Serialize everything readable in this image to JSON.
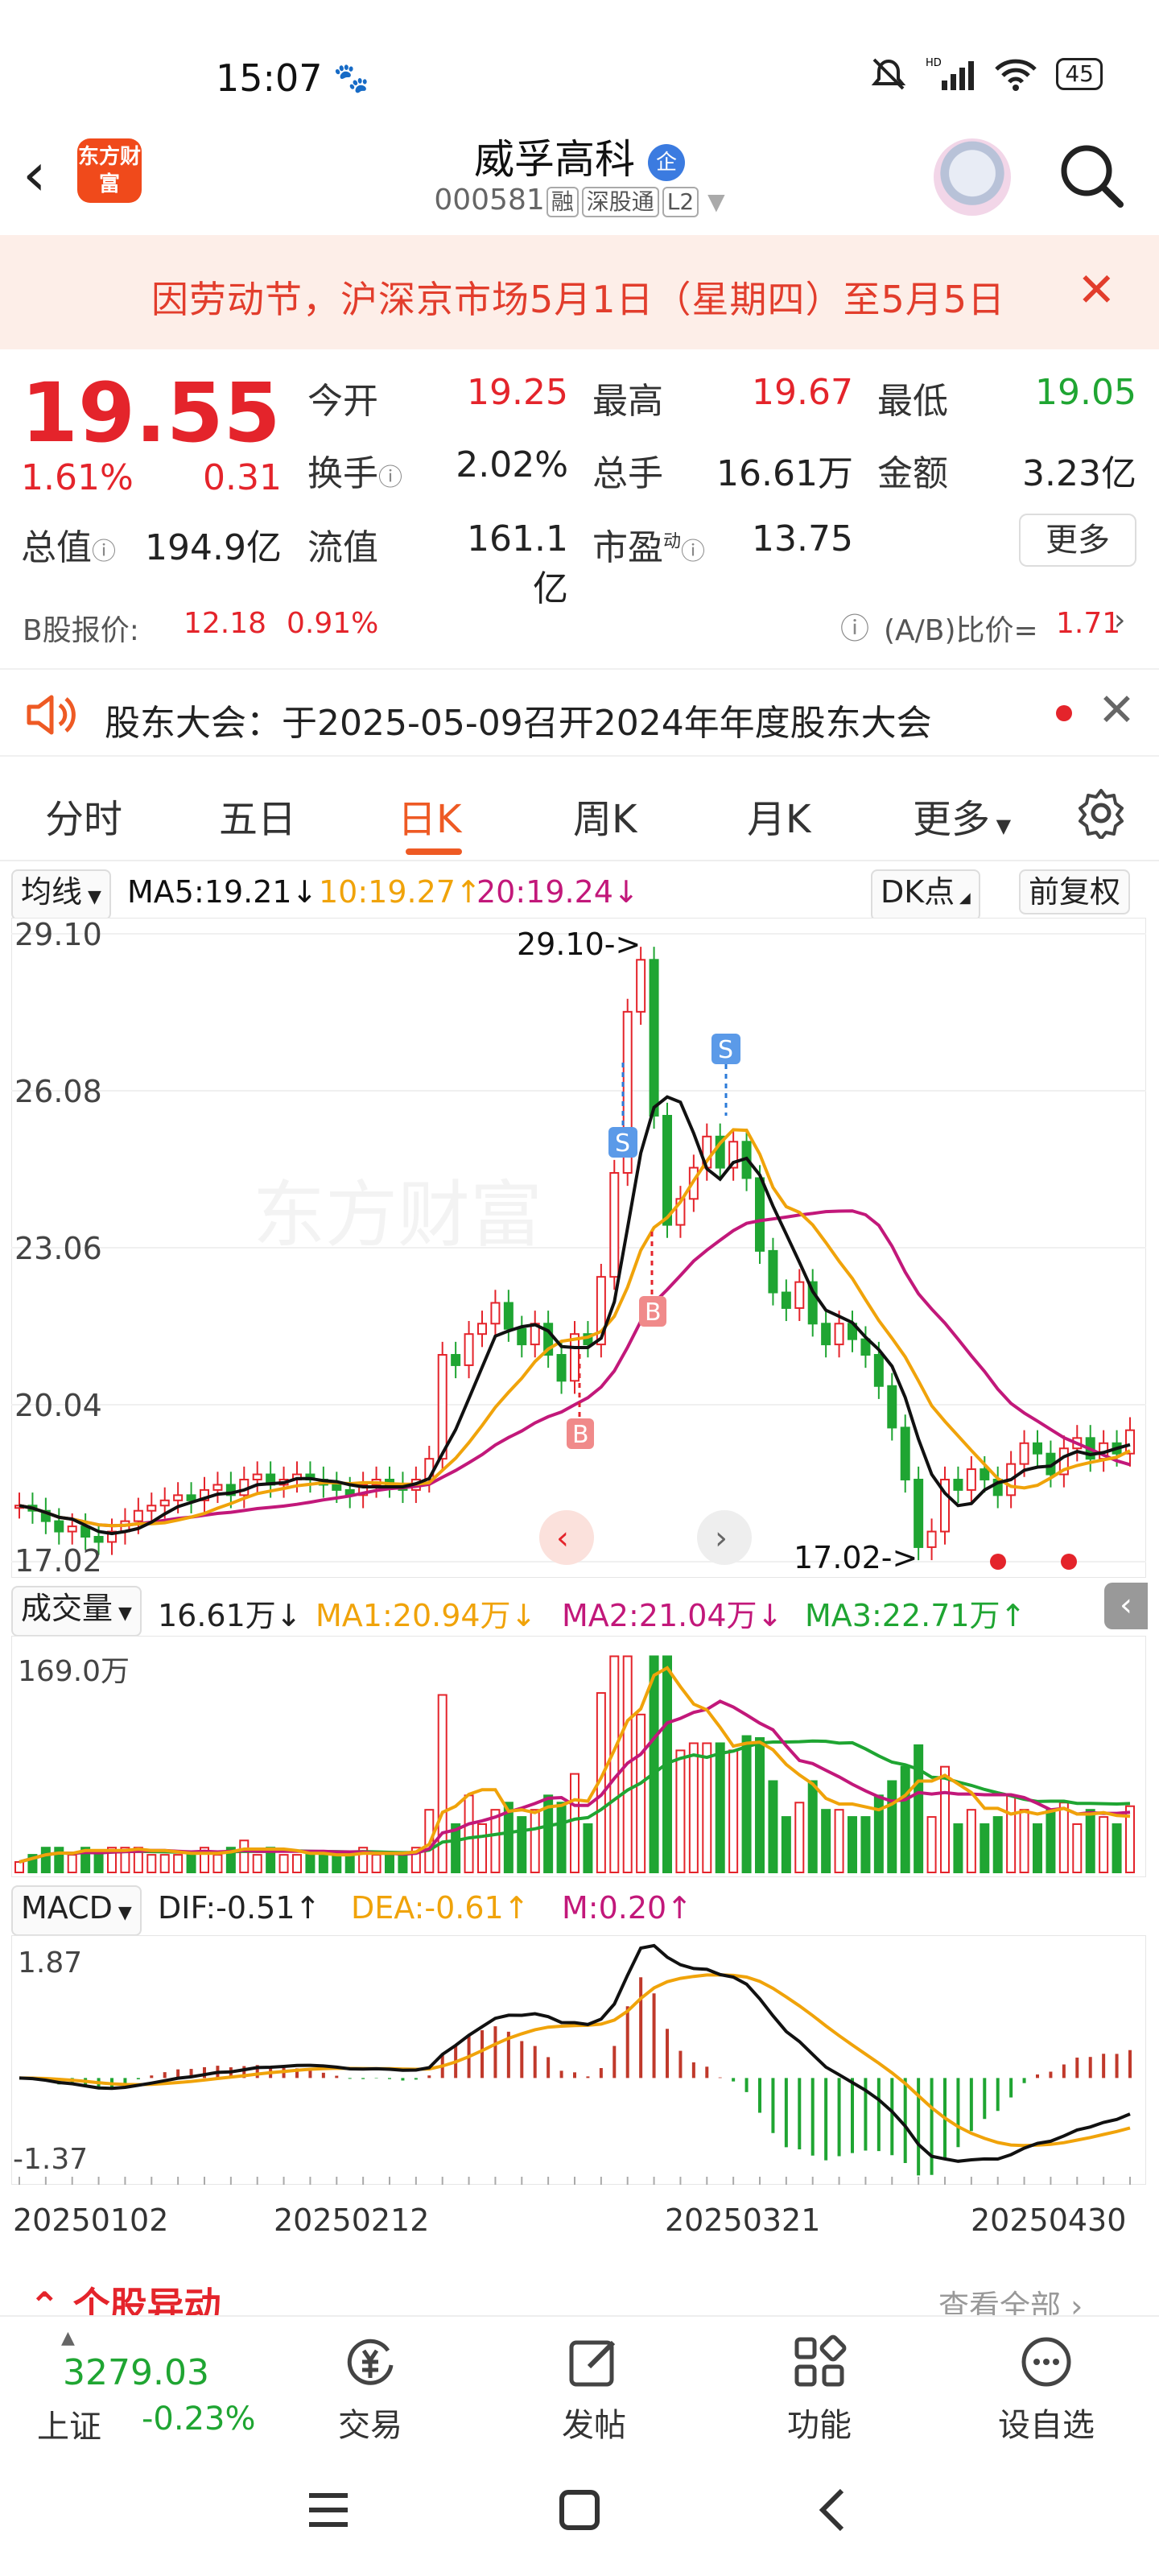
{
  "status_bar": {
    "time": "15:07",
    "hd": "HD",
    "battery": "45"
  },
  "header": {
    "logo_text": "东方财富",
    "stock_name": "威孚高科",
    "badge": "企",
    "code": "000581",
    "tags": [
      "融",
      "深股通",
      "L2"
    ]
  },
  "notice": {
    "text": "因劳动节，沪深京市场5月1日（星期四）至5月5日"
  },
  "quote": {
    "price": "19.55",
    "change_pct": "1.61%",
    "change": "0.31",
    "fields": {
      "open_label": "今开",
      "open": "19.25",
      "high_label": "最高",
      "high": "19.67",
      "low_label": "最低",
      "low": "19.05",
      "turnover_label": "换手",
      "turnover": "2.02%",
      "vol_label": "总手",
      "vol": "16.61万",
      "amount_label": "金额",
      "amount": "3.23亿",
      "mktcap_label": "总值",
      "mktcap": "194.9亿",
      "float_label": "流值",
      "float": "161.1亿",
      "pe_label": "市盈",
      "pe_sup": "动",
      "pe": "13.75"
    },
    "more_label": "更多"
  },
  "b_share": {
    "label": "B股报价:",
    "price": "12.18",
    "pct": "0.91%",
    "ratio_label": "(A/B)比价=",
    "ratio": "1.71"
  },
  "meeting": {
    "text": "股东大会：于2025-05-09召开2024年年度股东大会"
  },
  "tabs": [
    "分时",
    "五日",
    "日K",
    "周K",
    "月K",
    "更多"
  ],
  "active_tab": "日K",
  "ma_line": {
    "selector": "均线",
    "ma5": "MA5:19.21",
    "ma10": "10:19.27",
    "ma20": "20:19.24",
    "dk_label": "DK点",
    "adjust_label": "前复权"
  },
  "kchart_labels": {
    "y_ticks": [
      "29.10",
      "26.08",
      "23.06",
      "20.04",
      "17.02"
    ],
    "high_annot": "29.10->",
    "low_annot": "17.02->",
    "buy": "B",
    "sell": "S"
  },
  "volume_line": {
    "selector": "成交量",
    "vol": "16.61万",
    "ma1": "MA1:20.94万",
    "ma2": "MA2:21.04万",
    "ma3": "MA3:22.71万",
    "y_top": "169.0万"
  },
  "macd_line": {
    "selector": "MACD",
    "dif": "DIF:-0.51",
    "dea": "DEA:-0.61",
    "m": "M:0.20",
    "y_top": "1.87",
    "y_bottom": "-1.37"
  },
  "dates": [
    "20250102",
    "20250212",
    "20250321",
    "20250430"
  ],
  "activity": {
    "title": "个股异动",
    "view_all": "查看全部"
  },
  "bottom_bar": {
    "index_value": "3279.03",
    "index_name": "上证",
    "index_pct": "-0.23%",
    "items": [
      "交易",
      "发帖",
      "功能",
      "设自选"
    ]
  },
  "colors": {
    "up": "#e4242b",
    "down": "#1fa532",
    "accent": "#ee5a24",
    "ma5": "#111111",
    "ma10": "#f0a30a",
    "ma20": "#c2187a"
  },
  "chart_data": [
    {
      "type": "candlestick",
      "title": "日K",
      "ylim": [
        17.02,
        29.1
      ],
      "y_ticks": [
        29.1,
        26.08,
        23.06,
        20.04,
        17.02
      ],
      "x_labels": [
        "20250102",
        "20250212",
        "20250321",
        "20250430"
      ],
      "close_series": [
        18.1,
        18.0,
        17.8,
        17.6,
        17.7,
        17.5,
        17.4,
        17.6,
        17.8,
        18.0,
        18.1,
        18.2,
        18.3,
        18.2,
        18.4,
        18.5,
        18.3,
        18.6,
        18.7,
        18.5,
        18.6,
        18.7,
        18.6,
        18.5,
        18.4,
        18.3,
        18.5,
        18.6,
        18.5,
        18.4,
        18.6,
        19.0,
        21.0,
        20.8,
        21.4,
        21.6,
        22.0,
        21.5,
        21.2,
        21.6,
        21.0,
        20.5,
        21.4,
        21.2,
        22.5,
        24.5,
        27.6,
        28.6,
        25.6,
        23.5,
        24.0,
        24.6,
        25.2,
        24.6,
        25.1,
        24.4,
        23.0,
        22.2,
        21.9,
        22.4,
        21.6,
        21.2,
        21.6,
        21.3,
        21.0,
        20.4,
        19.6,
        18.6,
        17.3,
        17.6,
        18.6,
        18.4,
        18.8,
        18.6,
        18.3,
        18.9,
        19.3,
        19.1,
        18.7,
        19.2,
        19.4,
        19.0,
        19.3,
        19.1,
        19.55
      ],
      "series": [
        {
          "name": "MA5",
          "value": 19.21
        },
        {
          "name": "MA10",
          "value": 19.27
        },
        {
          "name": "MA20",
          "value": 19.24
        }
      ],
      "annotations": [
        "29.10->",
        "17.02->",
        "B",
        "S"
      ]
    },
    {
      "type": "bar",
      "title": "成交量",
      "ylim": [
        0,
        169.0
      ],
      "unit": "万",
      "series": [
        {
          "name": "MA1",
          "value": 20.94
        },
        {
          "name": "MA2",
          "value": 21.04
        },
        {
          "name": "MA3",
          "value": 22.71
        }
      ],
      "volume_latest": 16.61
    },
    {
      "type": "bar",
      "title": "MACD",
      "ylim": [
        -1.37,
        1.87
      ],
      "series": [
        {
          "name": "DIF",
          "value": -0.51
        },
        {
          "name": "DEA",
          "value": -0.61
        },
        {
          "name": "M",
          "value": 0.2
        }
      ]
    }
  ]
}
